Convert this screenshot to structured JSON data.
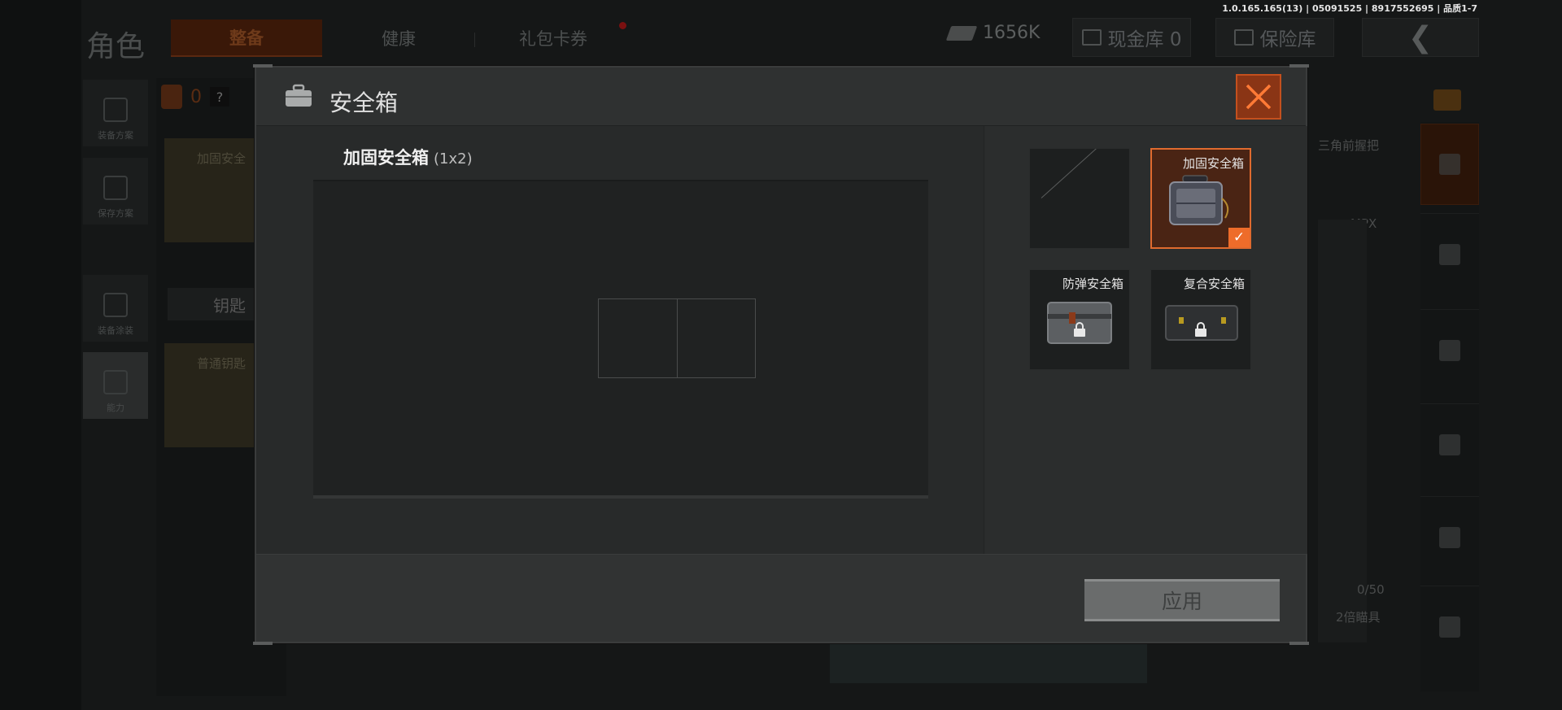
{
  "version_text": "1.0.165.165(13) | 05091525 | 8917552695 | 品质1-7",
  "background": {
    "page_title": "角色",
    "tabs": [
      {
        "label": "整备",
        "active": true
      },
      {
        "label": "健康",
        "active": false
      },
      {
        "label": "礼包卡券",
        "active": false
      }
    ],
    "currency_amount": "1656K",
    "cash_vault_label": "现金库 0",
    "safe_vault_label": "保险库",
    "side_buttons": [
      {
        "label": "装备方案",
        "icon": "backpack-icon"
      },
      {
        "label": "保存方案",
        "icon": "download-icon"
      },
      {
        "label": "装备涂装",
        "icon": "helmet-icon"
      },
      {
        "label": "能力",
        "icon": "lightning-hex-icon"
      }
    ],
    "vest_count": "0",
    "left_cards": [
      "加固安全",
      "普通钥匙"
    ],
    "key_bar_label": "钥匙",
    "right_labels": {
      "grip": "三角前握把",
      "weapon": "MPX",
      "ammo": "0/50",
      "scope": "2倍瞄具"
    }
  },
  "modal": {
    "title": "安全箱",
    "header_icon": "briefcase-icon",
    "selected_case_name": "加固安全箱",
    "selected_case_size": "(1x2)",
    "case_options": [
      {
        "label": "",
        "state": "empty"
      },
      {
        "label": "加固安全箱",
        "state": "selected"
      },
      {
        "label": "防弹安全箱",
        "state": "locked"
      },
      {
        "label": "复合安全箱",
        "state": "locked"
      }
    ],
    "apply_label": "应用",
    "close_icon": "close-icon",
    "accent_color": "#ee6c2a"
  }
}
